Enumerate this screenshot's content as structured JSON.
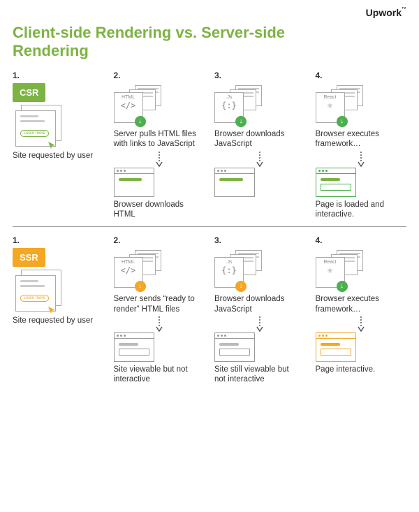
{
  "brand": "Upwork",
  "title": "Client-side Rendering vs. Server-side Rendering",
  "colors": {
    "green": "#7cb342",
    "orange": "#f5a623",
    "gray": "#999999"
  },
  "csr": {
    "badge": "CSR",
    "steps": [
      {
        "num": "1.",
        "caption": "Site requested by user",
        "learn_label": "Learn more"
      },
      {
        "num": "2.",
        "file_label": "HTML",
        "file_glyph": "</>",
        "caption": "Server pulls HTML files with links to JavaScript",
        "result_caption": "Browser downloads HTML"
      },
      {
        "num": "3.",
        "file_label": ".Js",
        "file_glyph": "{:}",
        "caption": "Browser downloads JavaScript",
        "result_caption": ""
      },
      {
        "num": "4.",
        "file_label": "React",
        "file_glyph": "⚛",
        "caption": "Browser executes framework…",
        "result_caption": "Page is loaded and interactive."
      }
    ]
  },
  "ssr": {
    "badge": "SSR",
    "steps": [
      {
        "num": "1.",
        "caption": "Site requested by user",
        "learn_label": "Learn more"
      },
      {
        "num": "2.",
        "file_label": "HTML",
        "file_glyph": "</>",
        "caption": "Server sends “ready to render” HTML files",
        "result_caption": "Site viewable but not interactive"
      },
      {
        "num": "3.",
        "file_label": ".Js",
        "file_glyph": "{:}",
        "caption": "Browser downloads JavaScript",
        "result_caption": "Site still viewable but not interactive"
      },
      {
        "num": "4.",
        "file_label": "React",
        "file_glyph": "⚛",
        "caption": "Browser executes framework…",
        "result_caption": "Page interactive."
      }
    ]
  }
}
